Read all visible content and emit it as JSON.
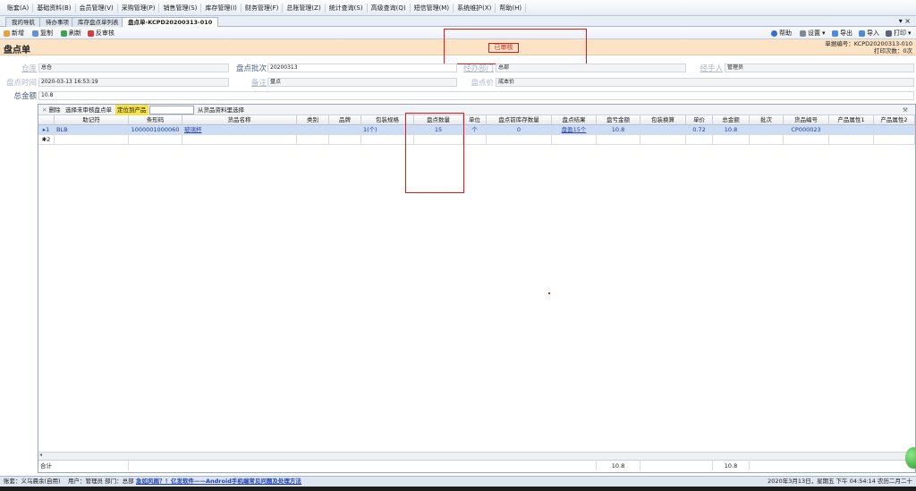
{
  "menu": [
    "账套(A)",
    "基础资料(B)",
    "会员管理(V)",
    "采购管理(P)",
    "销售管理(S)",
    "库存管理(I)",
    "财务管理(F)",
    "总账管理(Z)",
    "统计查询(S)",
    "高级查询(Q)",
    "短信管理(M)",
    "系统维护(X)",
    "帮助(H)"
  ],
  "tabs": [
    "我的导航",
    "待办事项",
    "库存盘点单列表",
    "盘点单-KCPD20200313-010"
  ],
  "toolbar": {
    "new": "新增",
    "copy": "复制",
    "refresh": "刷新",
    "unaudit": "反审核",
    "help": "帮助",
    "settings": "设置",
    "export": "导出",
    "import": "导入",
    "print": "打印"
  },
  "doc": {
    "title": "盘点单",
    "status": "已审核",
    "doc_no": "单据编号：KCPD20200313-010",
    "print_count": "打印次数：0次"
  },
  "form": {
    "warehouse_label": "仓库",
    "warehouse": "总仓",
    "batch_label": "盘点批次",
    "batch": "20200313",
    "dept_label": "经办部门",
    "dept": "总部",
    "handler_label": "经手人",
    "handler": "管理员",
    "time_label": "盘点时间",
    "time": "2020-03-13 16:53:19",
    "remark_label": "备注",
    "remark": "盘点",
    "price_label": "盘点价",
    "price": "成本价",
    "total_label": "总金额",
    "total": "10.8"
  },
  "grid_toolbar": {
    "delete": "删除",
    "select_unaudited": "选择未审核盘点单",
    "locate": "定位到产品",
    "from_info": "从货品资料里选择"
  },
  "columns": [
    "助记符",
    "条形码",
    "货品名称",
    "类别",
    "品牌",
    "包装规格",
    "盘点数量",
    "单位",
    "盘点前库存数量",
    "盘点结果",
    "盘亏金额",
    "包装换算",
    "单价",
    "总金额",
    "批次",
    "货品编号",
    "产品属性1",
    "产品属性2"
  ],
  "rows": [
    {
      "no": "1",
      "code": "BLB",
      "barcode": "1000001000060",
      "name": "玻璃杯",
      "category": "",
      "brand": "",
      "spec": "1(个)",
      "qty": "15",
      "unit": "个",
      "before": "0",
      "result": "盘盈15个",
      "loss": "10.8",
      "conv": "",
      "price": "0.72",
      "amount": "10.8",
      "lot": "",
      "sku": "CP000023",
      "attr1": "",
      "attr2": ""
    },
    {
      "no": "2",
      "code": "",
      "barcode": "",
      "name": "",
      "category": "",
      "brand": "",
      "spec": "",
      "qty": "",
      "unit": "",
      "before": "",
      "result": "",
      "loss": "",
      "conv": "",
      "price": "",
      "amount": "",
      "lot": "",
      "sku": "",
      "attr1": "",
      "attr2": ""
    }
  ],
  "footer": {
    "label": "合计",
    "loss_total": "10.8",
    "amount_total": "10.8"
  },
  "status": {
    "company": "账套：义乌晨余(自用)",
    "user": "用户：管理员  部门：总部",
    "news": "急如风雨？！亿发软件——Android手机端常见问题及处理方法",
    "datetime": "2020年3月13日，星期五 下午 04:54:14 农历二月二十"
  }
}
